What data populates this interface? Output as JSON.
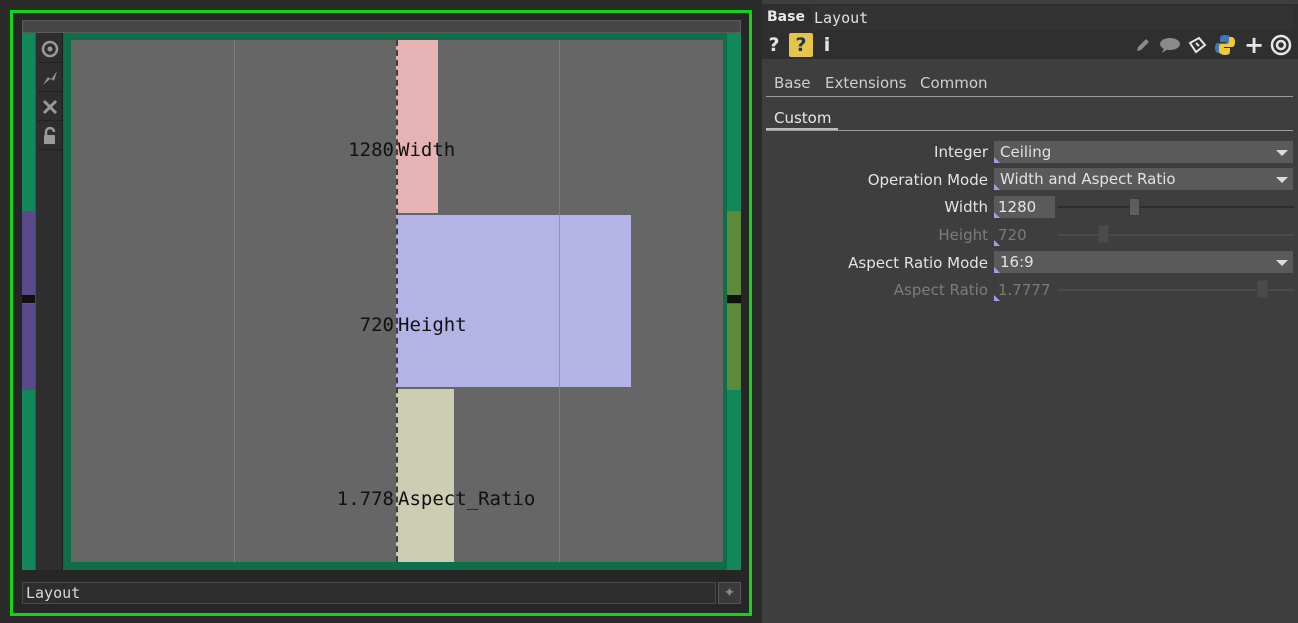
{
  "network": {
    "footer_label": "Layout",
    "bars": [
      {
        "value": "1280",
        "name": "Width",
        "color": "#e5b3b3"
      },
      {
        "value": "720",
        "name": "Height",
        "color": "#b3b3e6"
      },
      {
        "value": "1.778",
        "name": "Aspect_Ratio",
        "color": "#cccdb3"
      }
    ]
  },
  "params": {
    "op_type": "Base",
    "op_name": "Layout",
    "header_icons": [
      "help-icon",
      "python-help-icon",
      "info-icon",
      "edit-icon",
      "comment-icon",
      "clone-icon",
      "python-icon",
      "add-icon",
      "viewer-icon"
    ],
    "page_tabs": [
      "Base",
      "Extensions",
      "Common"
    ],
    "active_tab": "Custom",
    "rows": {
      "integer": {
        "label": "Integer",
        "value": "Ceiling"
      },
      "operation_mode": {
        "label": "Operation Mode",
        "value": "Width and Aspect Ratio"
      },
      "width": {
        "label": "Width",
        "value": "1280"
      },
      "height": {
        "label": "Height",
        "value": "720"
      },
      "aspect_ratio_mode": {
        "label": "Aspect Ratio Mode",
        "value": "16:9"
      },
      "aspect_ratio": {
        "label": "Aspect Ratio",
        "value": "1.7777"
      }
    }
  }
}
